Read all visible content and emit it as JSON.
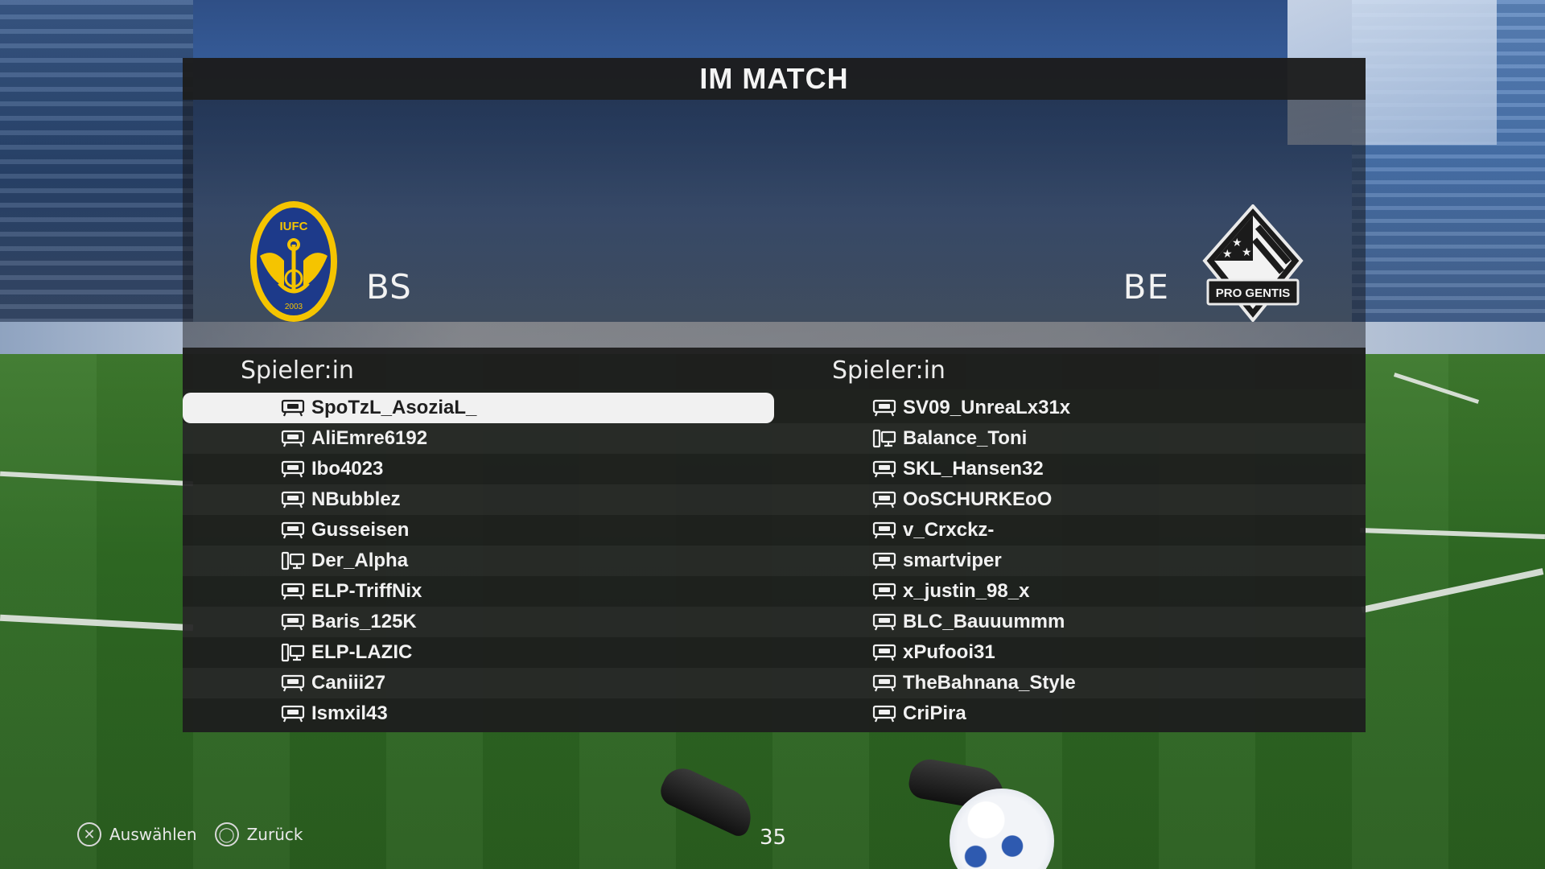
{
  "title": "IM MATCH",
  "home_team": {
    "abbr": "BS",
    "crest_text": "IUFC",
    "crest_year": "2003"
  },
  "away_team": {
    "abbr": "BE",
    "crest_text": "PRO GENTIS"
  },
  "home": {
    "header": "Spieler:in",
    "players": [
      {
        "name": "SpoTzL_AsoziaL_",
        "platform": "console-icon"
      },
      {
        "name": "AliEmre6192",
        "platform": "console-icon"
      },
      {
        "name": "Ibo4023",
        "platform": "console-icon"
      },
      {
        "name": "NBubblez",
        "platform": "console-icon"
      },
      {
        "name": "Gusseisen",
        "platform": "console-icon"
      },
      {
        "name": "Der_Alpha",
        "platform": "pc-icon"
      },
      {
        "name": "ELP-TriffNix",
        "platform": "console-icon"
      },
      {
        "name": "Baris_125K",
        "platform": "console-icon"
      },
      {
        "name": "ELP-LAZIC",
        "platform": "pc-icon"
      },
      {
        "name": "Caniii27",
        "platform": "console-icon"
      },
      {
        "name": "Ismxil43",
        "platform": "console-icon"
      }
    ]
  },
  "away": {
    "header": "Spieler:in",
    "players": [
      {
        "name": "SV09_UnreaLx31x",
        "platform": "console-icon"
      },
      {
        "name": "Balance_Toni",
        "platform": "pc-icon"
      },
      {
        "name": "SKL_Hansen32",
        "platform": "console-icon"
      },
      {
        "name": "OoSCHURKEoO",
        "platform": "console-icon"
      },
      {
        "name": "v_Crxckz-",
        "platform": "console-icon"
      },
      {
        "name": "smartviper",
        "platform": "console-icon"
      },
      {
        "name": "x_justin_98_x",
        "platform": "console-icon"
      },
      {
        "name": "BLC_Bauuummm",
        "platform": "console-icon"
      },
      {
        "name": "xPufooi31",
        "platform": "console-icon"
      },
      {
        "name": "TheBahnana_Style",
        "platform": "console-icon"
      },
      {
        "name": "CriPira",
        "platform": "console-icon"
      }
    ]
  },
  "selected": {
    "team": "home",
    "index": 0
  },
  "footer": {
    "select_label": "Auswählen",
    "select_icon": "cross-button-icon",
    "back_label": "Zurück",
    "back_icon": "circle-button-icon",
    "timer": "35"
  },
  "colors": {
    "panel": "#1e1e1e",
    "selected_row": "#f1f1f1",
    "home_crest": "#f5c400",
    "home_crest_bg": "#1d3a8a"
  }
}
